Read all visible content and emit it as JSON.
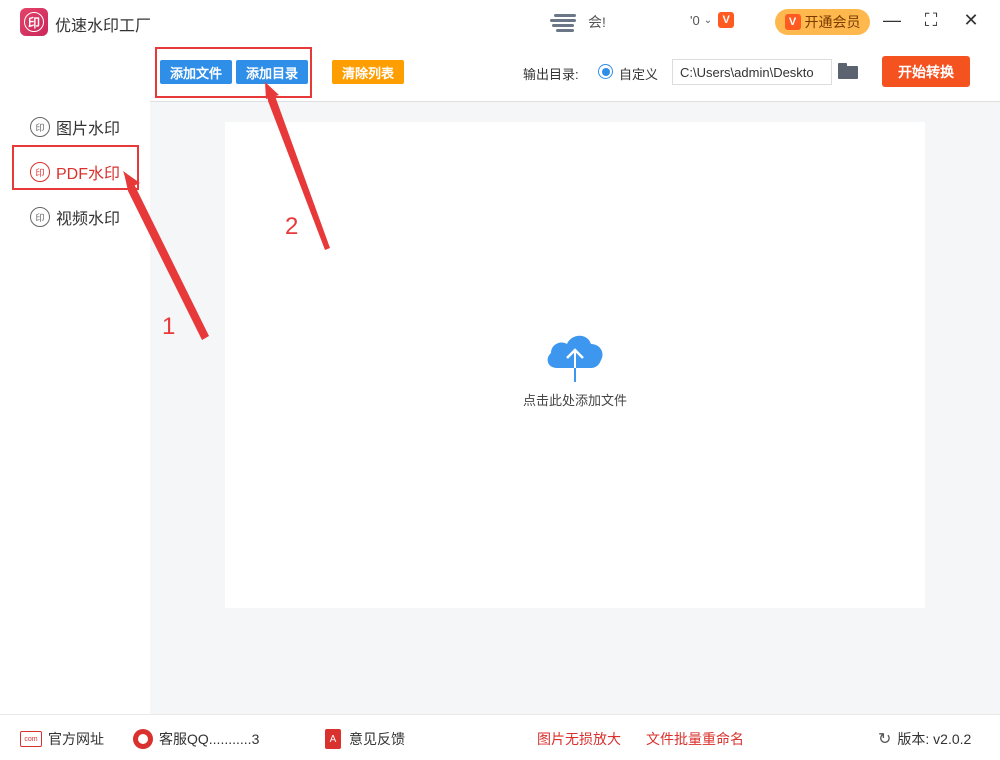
{
  "app": {
    "title": "优速水印工厂",
    "logo_text": "印"
  },
  "header": {
    "user_text": "会!",
    "count": "'0",
    "count_badge": "V",
    "vip_badge": "V",
    "vip_label": "开通会员",
    "minimize": "—",
    "maximize": "⛶",
    "close": "✕"
  },
  "sidebar": {
    "items": [
      {
        "icon": "印",
        "label": "图片水印"
      },
      {
        "icon": "印",
        "label": "PDF水印"
      },
      {
        "icon": "印",
        "label": "视频水印"
      }
    ]
  },
  "toolbar": {
    "add_file": "添加文件",
    "add_dir": "添加目录",
    "clear_list": "清除列表",
    "output_label": "输出目录:",
    "radio_label": "自定义",
    "path_value": "C:\\Users\\admin\\Deskto",
    "start": "开始转换"
  },
  "drop": {
    "text": "点击此处添加文件"
  },
  "footer": {
    "site_icon": "com",
    "site": "官方网址",
    "qq": "客服QQ...........3",
    "pdf_icon": "A",
    "feedback": "意见反馈",
    "enlarge": "图片无损放大",
    "rename": "文件批量重命名",
    "version": "版本: v2.0.2"
  },
  "annotations": {
    "n1": "1",
    "n2": "2"
  },
  "colors": {
    "accent_blue": "#2f8ee8",
    "accent_red": "#d9312d",
    "start_orange": "#f4521f",
    "clear_orange": "#ff9e00",
    "vip_gold": "#ffb84d"
  }
}
